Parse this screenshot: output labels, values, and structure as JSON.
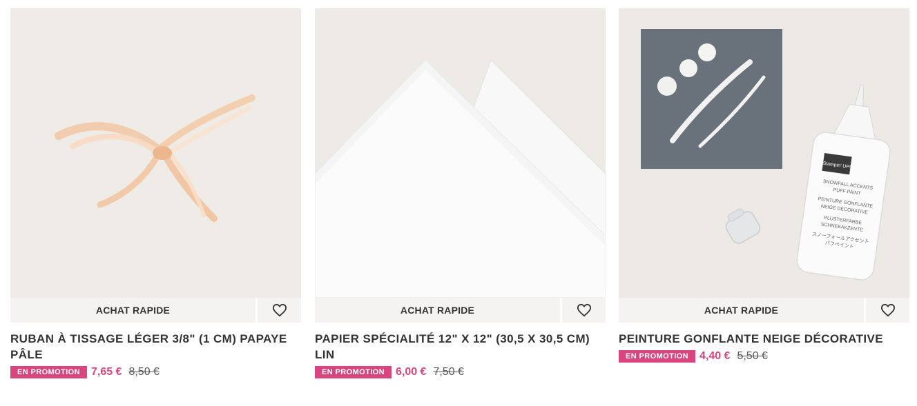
{
  "products": [
    {
      "image": "ribbon-bow-image",
      "quick_label": "ACHAT RAPIDE",
      "wishlist_icon": "heart-icon",
      "title": "RUBAN À TISSAGE LÉGER 3/8\" (1 CM) PAPAYE PÂLE",
      "promo_label": "EN PROMOTION",
      "sale_price": "7,65 €",
      "original_price": "8,50 €"
    },
    {
      "image": "white-paper-image",
      "quick_label": "ACHAT RAPIDE",
      "wishlist_icon": "heart-icon",
      "title": "PAPIER SPÉCIALITÉ 12\" X 12\" (30,5 X 30,5 CM) LIN",
      "promo_label": "EN PROMOTION",
      "sale_price": "6,00 €",
      "original_price": "7,50 €"
    },
    {
      "image": "puff-paint-bottle-image",
      "quick_label": "ACHAT RAPIDE",
      "wishlist_icon": "heart-icon",
      "title": "PEINTURE GONFLANTE NEIGE DÉCORATIVE",
      "promo_label": "EN PROMOTION",
      "sale_price": "4,40 €",
      "original_price": "5,50 €",
      "bottle_label": {
        "brand": "Stampin' UP!",
        "line1": "SNOWFALL ACCENTS",
        "line2": "PUFF PAINT",
        "line3": "PEINTURE GONFLANTE",
        "line4": "NEIGE DÉCORATIVE",
        "line5": "PLUSTERFARBE",
        "line6": "SCHNEEAKZENTE",
        "line7": "スノーフォールアクセント",
        "line8": "パフペイント"
      }
    }
  ],
  "colors": {
    "promo": "#d9467f",
    "text": "#333333",
    "image_bg": "#efebe6"
  }
}
